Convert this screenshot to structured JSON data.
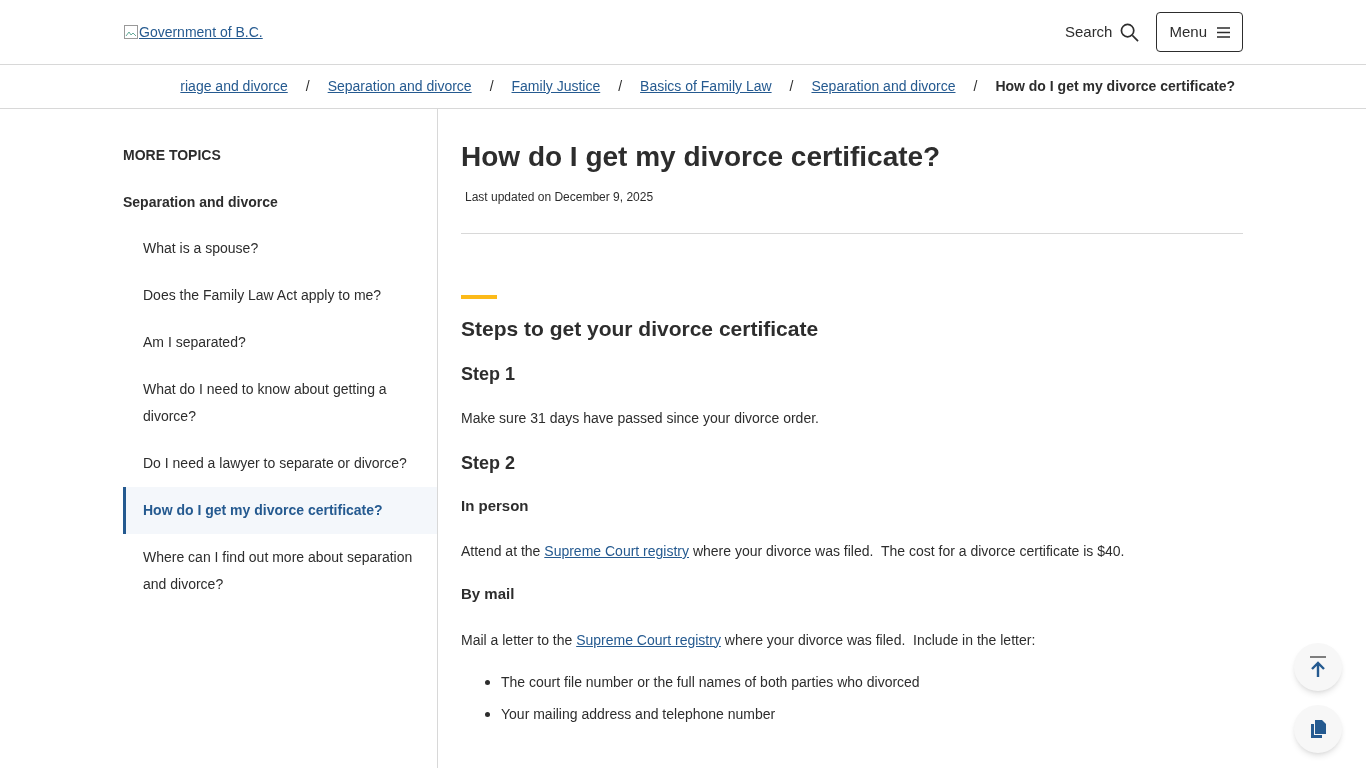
{
  "header": {
    "logo_alt": "Government of B.C.",
    "search_label": "Search",
    "menu_label": "Menu"
  },
  "breadcrumbs": [
    {
      "label": "riage and divorce",
      "current": false
    },
    {
      "label": "Separation and divorce",
      "current": false
    },
    {
      "label": "Family Justice",
      "current": false
    },
    {
      "label": "Basics of Family Law",
      "current": false
    },
    {
      "label": "Separation and divorce",
      "current": false
    },
    {
      "label": "How do I get my divorce certificate?",
      "current": true
    }
  ],
  "breadcrumb_separator": "/",
  "sidebar": {
    "heading": "MORE TOPICS",
    "section": "Separation and divorce",
    "items": [
      {
        "label": "What is a spouse?",
        "selected": false
      },
      {
        "label": "Does the Family Law Act apply to me?",
        "selected": false
      },
      {
        "label": "Am I separated?",
        "selected": false
      },
      {
        "label": "What do I need to know about getting a divorce?",
        "selected": false
      },
      {
        "label": "Do I need a lawyer to separate or divorce?",
        "selected": false
      },
      {
        "label": "How do I get my divorce certificate?",
        "selected": true
      },
      {
        "label": "Where can I find out more about separation and divorce?",
        "selected": false
      }
    ]
  },
  "article": {
    "title": "How do I get my divorce certificate?",
    "updated": "Last updated on December 9, 2025",
    "section_title": "Steps to get your divorce certificate",
    "blocks": [
      {
        "kind": "h3",
        "text": "Step 1"
      },
      {
        "kind": "p",
        "parts": [
          {
            "text": "Make sure 31 days have passed since your divorce order.",
            "link": false
          }
        ]
      },
      {
        "kind": "h3",
        "text": "Step 2"
      },
      {
        "kind": "h4",
        "text": "In person"
      },
      {
        "kind": "p",
        "parts": [
          {
            "text": "Attend at the ",
            "link": false
          },
          {
            "text": "Supreme Court registry",
            "link": true
          },
          {
            "text": " where your divorce was filed.  The cost for a divorce certificate is $40.",
            "link": false
          }
        ]
      },
      {
        "kind": "h4",
        "text": "By mail"
      },
      {
        "kind": "p",
        "parts": [
          {
            "text": "Mail a letter to the ",
            "link": false
          },
          {
            "text": "Supreme Court registry",
            "link": true
          },
          {
            "text": " where your divorce was filed.  Include in the letter:",
            "link": false
          }
        ]
      },
      {
        "kind": "ul",
        "items": [
          "The court file number or the full names of both parties who divorced",
          "Your mailing address and telephone number"
        ]
      }
    ]
  }
}
